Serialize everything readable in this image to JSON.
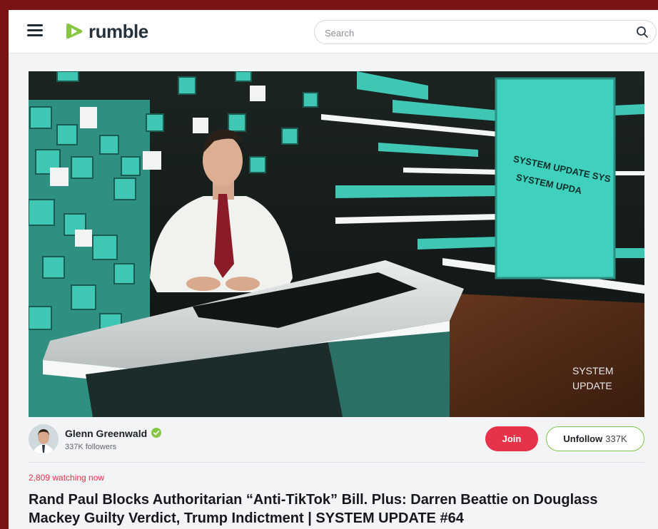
{
  "header": {
    "logo_text": "rumble",
    "search_placeholder": "Search"
  },
  "video": {
    "screen_text_1": "SYSTEM UPDATE SYS",
    "screen_text_2": "SYSTEM UPDA",
    "watermark_line1": "SYSTEM",
    "watermark_line2": "UPDATE"
  },
  "channel": {
    "name": "Glenn Greenwald",
    "followers": "337K followers",
    "join_label": "Join",
    "unfollow_label": "Unfollow",
    "unfollow_count": "337K"
  },
  "stream": {
    "watching": "2,809 watching now",
    "title": "Rand Paul Blocks Authoritarian “Anti-TikTok” Bill. Plus: Darren Beattie on Douglass Mackey Guilty Verdict, Trump Indictment | SYSTEM UPDATE #64"
  },
  "colors": {
    "brand_green": "#85c742",
    "join_red": "#e6334a",
    "watching_red": "#e0334a",
    "studio_teal": "#3fc7b4"
  }
}
